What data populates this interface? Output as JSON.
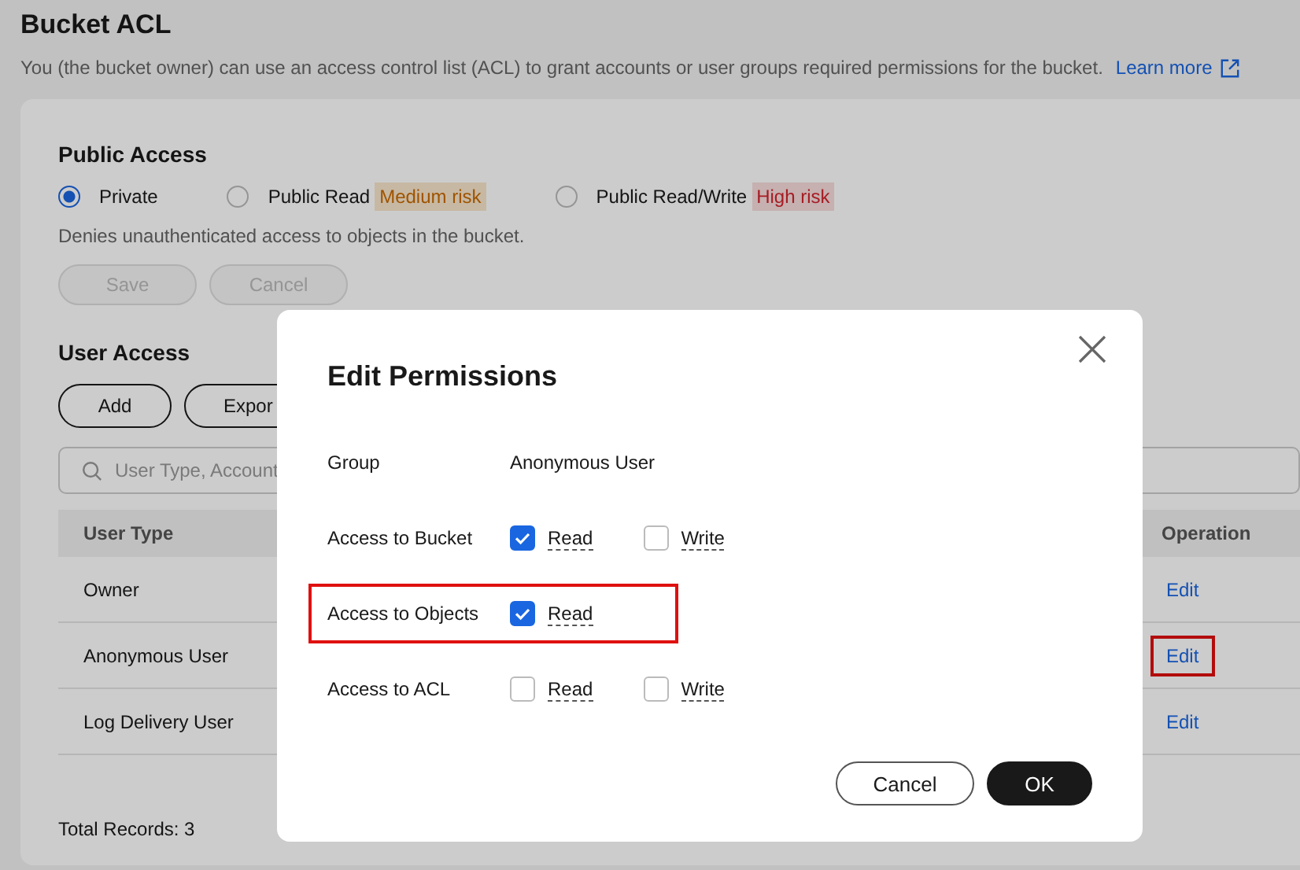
{
  "page": {
    "title": "Bucket ACL",
    "description": "You (the bucket owner) can use an access control list (ACL) to grant accounts or user groups required permissions for the bucket.",
    "link": "Learn more"
  },
  "public_access": {
    "title": "Public Access",
    "options": [
      {
        "label": "Private",
        "selected": true
      },
      {
        "label": "Public Read",
        "selected": false,
        "risk": "Medium risk",
        "kind": "medium"
      },
      {
        "label": "Public Read/Write",
        "selected": false,
        "risk": "High risk",
        "kind": "high"
      }
    ],
    "hint": "Denies unauthenticated access to objects in the bucket.",
    "buttons": [
      {
        "label": "Save",
        "disabled": true
      },
      {
        "label": "Cancel",
        "disabled": true
      }
    ]
  },
  "user_access": {
    "title": "User Access",
    "buttons": [
      "Add",
      "Expor"
    ],
    "search_placeholder": "User Type, Account",
    "table": {
      "columns": [
        "User Type",
        "Operation"
      ],
      "rows": [
        {
          "user_type": "Owner",
          "operation": "Edit",
          "highlighted": false
        },
        {
          "user_type": "Anonymous User",
          "operation": "Edit",
          "highlighted": true
        },
        {
          "user_type": "Log Delivery User",
          "operation": "Edit",
          "highlighted": false
        }
      ]
    },
    "total": "Total Records: 3"
  },
  "dialog": {
    "title": "Edit Permissions",
    "group_label": "Group",
    "group_value": "Anonymous User",
    "rows": [
      {
        "label": "Access to Bucket",
        "highlighted": false,
        "options": [
          {
            "label": "Read",
            "checked": true
          },
          {
            "label": "Write",
            "checked": false
          }
        ]
      },
      {
        "label": "Access to Objects",
        "highlighted": true,
        "options": [
          {
            "label": "Read",
            "checked": true
          }
        ]
      },
      {
        "label": "Access to ACL",
        "highlighted": false,
        "options": [
          {
            "label": "Read",
            "checked": false
          },
          {
            "label": "Write",
            "checked": false
          }
        ]
      }
    ],
    "buttons": [
      {
        "label": "Cancel",
        "kind": "secondary"
      },
      {
        "label": "OK",
        "kind": "primary"
      }
    ]
  }
}
